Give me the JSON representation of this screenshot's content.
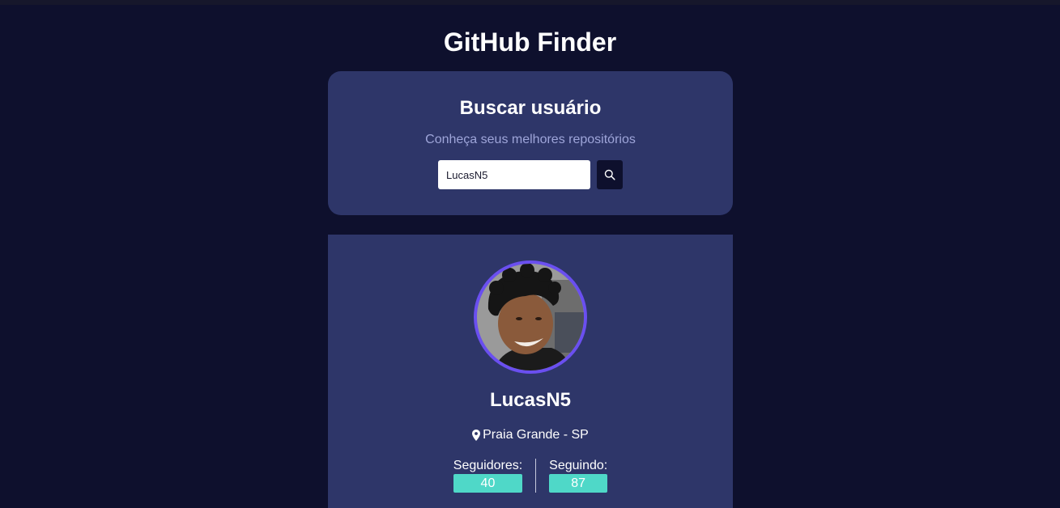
{
  "app": {
    "title": "GitHub Finder"
  },
  "search": {
    "heading": "Buscar usuário",
    "subtitle": "Conheça seus melhores repositórios",
    "input_value": "LucasN5",
    "button_icon": "search-icon"
  },
  "profile": {
    "username": "LucasN5",
    "location": "Praia Grande - SP",
    "location_icon": "map-pin-icon",
    "followers_label": "Seguidores:",
    "followers_count": "40",
    "following_label": "Seguindo:",
    "following_count": "87"
  },
  "colors": {
    "background": "#0e102d",
    "card": "#2e3669",
    "accent": "#6a4ff0",
    "stat_badge": "#4fd8c8",
    "subtitle": "#9ea5d9"
  }
}
